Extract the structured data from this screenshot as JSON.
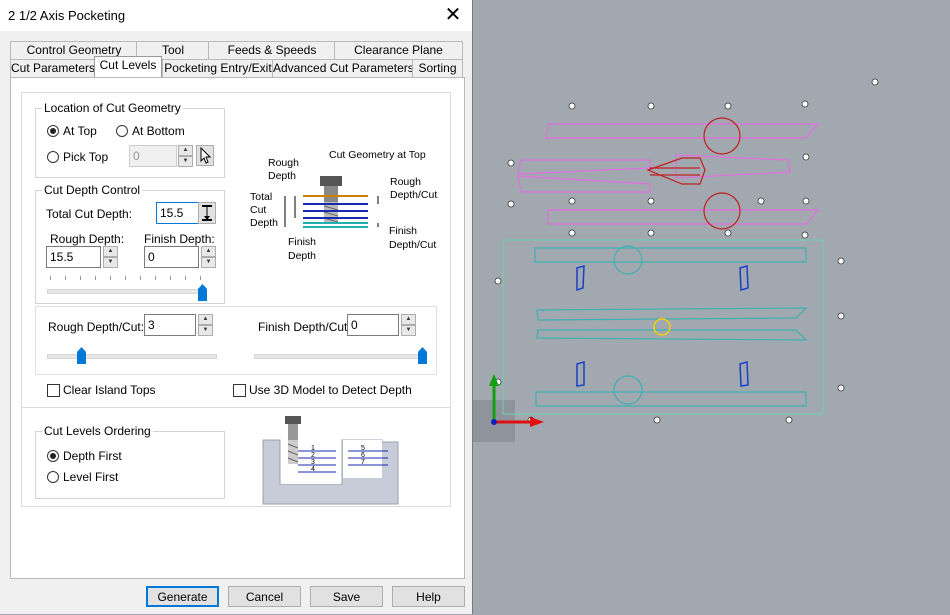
{
  "window": {
    "title": "2 1/2 Axis Pocketing",
    "close_glyph": "✕"
  },
  "tabs_row1": [
    "Control Geometry",
    "Tool",
    "Feeds & Speeds",
    "Clearance Plane"
  ],
  "tabs_row2": [
    "Cut Parameters",
    "Cut Levels",
    "Pocketing Entry/Exit",
    "Advanced Cut Parameters",
    "Sorting"
  ],
  "active_tab": "Cut Levels",
  "location": {
    "group_label": "Location of Cut Geometry",
    "at_top": "At Top",
    "at_bottom": "At Bottom",
    "pick_top": "Pick Top",
    "pick_value": "0",
    "selected": "At Top"
  },
  "cut_depth": {
    "group_label": "Cut Depth Control",
    "total_label": "Total Cut Depth:",
    "total_value": "15.5",
    "rough_label": "Rough Depth:",
    "rough_value": "15.5",
    "finish_label": "Finish Depth:",
    "finish_value": "0",
    "rough_finish_slider": 1.0
  },
  "per_cut": {
    "rough_label": "Rough Depth/Cut:",
    "rough_value": "3",
    "finish_label": "Finish Depth/Cut:",
    "finish_value": "0",
    "rough_slider": 0.2,
    "finish_slider": 1.0
  },
  "diagram1": {
    "rough_depth": "Rough\nDepth",
    "cut_geometry_at_top": "Cut Geometry at Top",
    "total_cut_depth": "Total\nCut\nDepth",
    "rough_depth_cut": "Rough\nDepth/Cut",
    "finish_depth": "Finish\nDepth",
    "finish_depth_cut": "Finish\nDepth/Cut"
  },
  "options": {
    "clear_island_tops": "Clear Island Tops",
    "use_3d_model": "Use 3D Model to Detect Depth"
  },
  "ordering": {
    "group_label": "Cut Levels Ordering",
    "depth_first": "Depth First",
    "level_first": "Level First",
    "selected": "Depth First",
    "diagram_levels_left": [
      "1",
      "2",
      "3",
      "4"
    ],
    "diagram_levels_right": [
      "5",
      "6",
      "7"
    ]
  },
  "buttons": {
    "generate": "Generate",
    "cancel": "Cancel",
    "save": "Save",
    "help": "Help"
  },
  "colors": {
    "accent": "#0078d7",
    "magenta": "#e070e0",
    "darkred": "#c02020",
    "teal": "#40b0b0",
    "blue_slots": "#1a3fc8",
    "yellow": "#f0d000"
  }
}
